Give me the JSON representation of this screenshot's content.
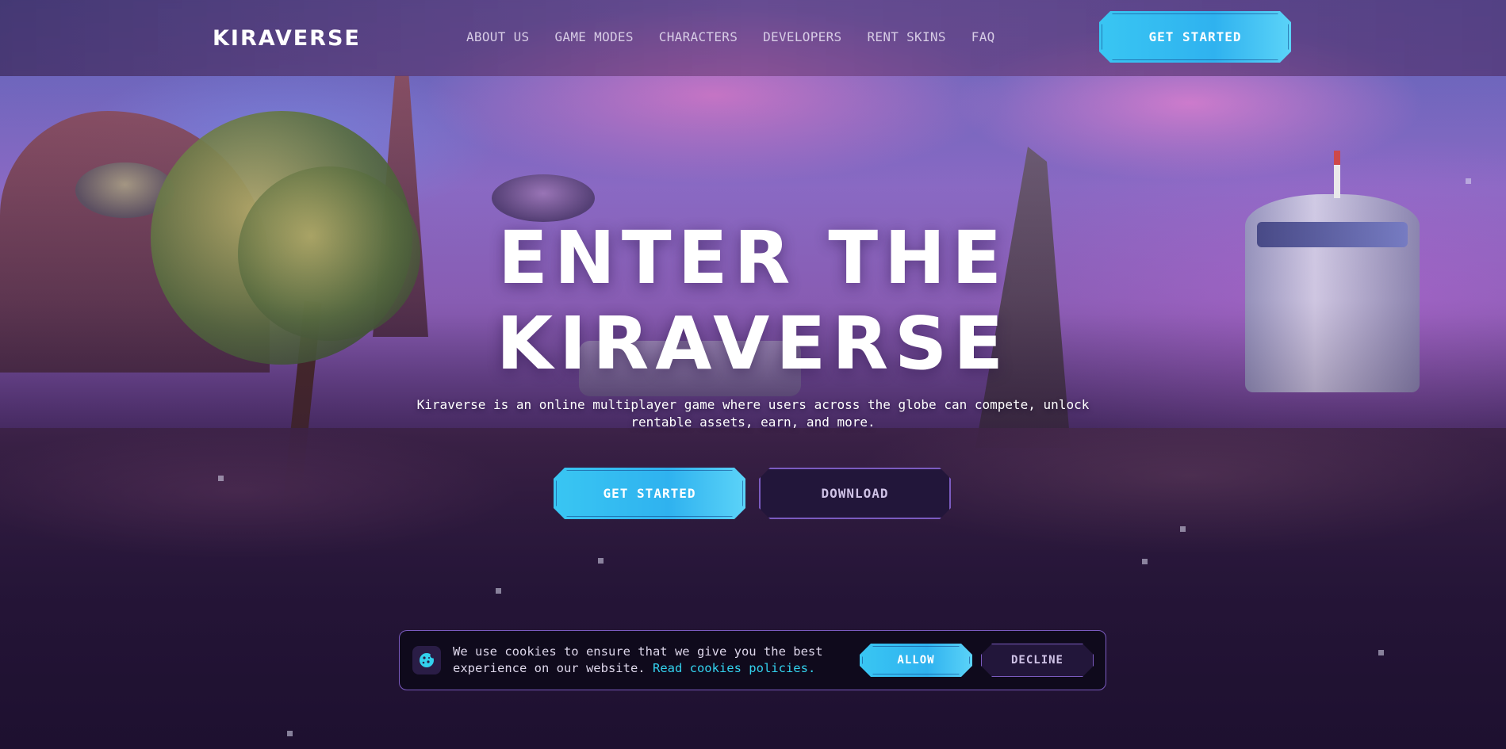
{
  "header": {
    "logo": "KIRAVERSE",
    "nav": [
      {
        "label": "ABOUT US"
      },
      {
        "label": "GAME MODES"
      },
      {
        "label": "CHARACTERS"
      },
      {
        "label": "DEVELOPERS"
      },
      {
        "label": "RENT SKINS"
      },
      {
        "label": "FAQ"
      }
    ],
    "cta_label": "GET STARTED"
  },
  "hero": {
    "title_line1": "ENTER THE",
    "title_line2": "KIRAVERSE",
    "subtitle": "Kiraverse is an online multiplayer game where users across the globe can compete, unlock rentable assets, earn, and more.",
    "primary_button": "GET STARTED",
    "secondary_button": "DOWNLOAD"
  },
  "cookie_banner": {
    "icon": "cookie-icon",
    "text": "We use cookies to ensure that we give you the best experience on our website.",
    "link_text": "Read cookies policies.",
    "allow_label": "ALLOW",
    "decline_label": "DECLINE"
  },
  "colors": {
    "accent_cyan": "#39c6f3",
    "accent_purple": "#7b5bc0",
    "link_cyan": "#33d2ee",
    "dark_panel": "#0f0a1c"
  }
}
